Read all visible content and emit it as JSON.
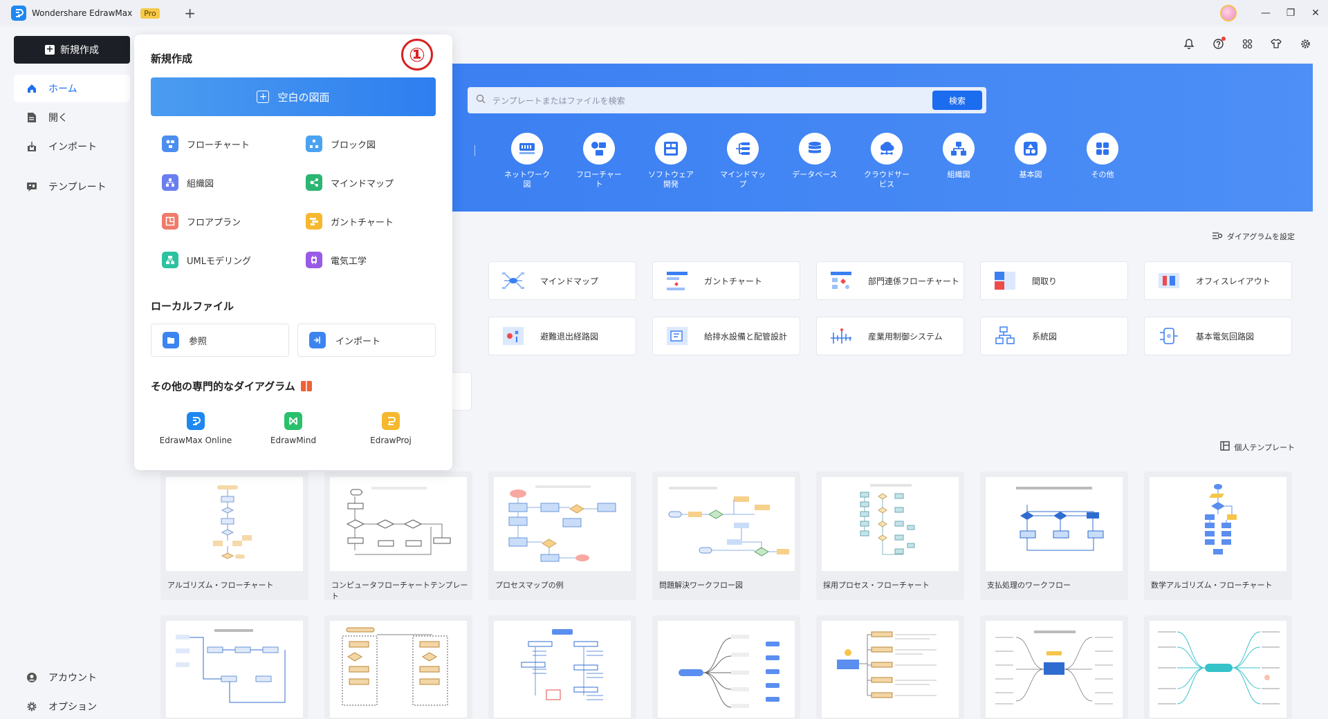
{
  "titlebar": {
    "app_name": "Wondershare EdrawMax",
    "badge": "Pro",
    "new_tab": "+",
    "minimize": "—",
    "restore": "❐",
    "close": "✕"
  },
  "sidebar": {
    "new_button": "新規作成",
    "items": [
      {
        "label": "ホーム",
        "icon": "home-icon"
      },
      {
        "label": "開く",
        "icon": "file-icon"
      },
      {
        "label": "インポート",
        "icon": "import-icon"
      },
      {
        "label": "テンプレート",
        "icon": "template-icon"
      }
    ],
    "bottom": [
      {
        "label": "アカウント",
        "icon": "account-icon"
      },
      {
        "label": "オプション",
        "icon": "gear-icon"
      }
    ]
  },
  "hero": {
    "search_placeholder": "テンプレートまたはファイルを検索",
    "search_button": "検索",
    "categories": [
      "ネットワーク図",
      "フローチャート",
      "ソフトウェア開発",
      "マインドマップ",
      "データベース",
      "クラウドサービス",
      "組織図",
      "基本図",
      "その他"
    ]
  },
  "main": {
    "set_diagram": "ダイアグラムを設定",
    "personal_templates": "個人テンプレート",
    "diagram_types_row1": [
      "マインドマップ",
      "ガントチャート",
      "部門連係フローチャート",
      "間取り",
      "オフィスレイアウト"
    ],
    "diagram_types_row2": [
      "避難退出経路図",
      "給排水設備と配管設計",
      "産業用制御システム",
      "系統図",
      "基本電気回路図"
    ],
    "templates": [
      "アルゴリズム・フローチャート",
      "コンピュータフローチャートテンプレート",
      "プロセスマップの例",
      "問題解決ワークフロー図",
      "採用プロセス・フローチャート",
      "支払処理のワークフロー",
      "数学アルゴリズム・フローチャート"
    ]
  },
  "panel": {
    "marker": "①",
    "title": "新規作成",
    "blank_label": "空白の図面",
    "items": [
      "フローチャート",
      "ブロック図",
      "組織図",
      "マインドマップ",
      "フロアプラン",
      "ガントチャート",
      "UMLモデリング",
      "電気工学"
    ],
    "local_title": "ローカルファイル",
    "browse": "参照",
    "import": "インポート",
    "other_title": "その他の専門的なダイアグラム",
    "products": [
      "EdrawMax Online",
      "EdrawMind",
      "EdrawProj"
    ]
  },
  "colors": {
    "accent": "#1e6ff2",
    "hero": "#3b7ff2",
    "dark_button": "#1c1f26"
  }
}
